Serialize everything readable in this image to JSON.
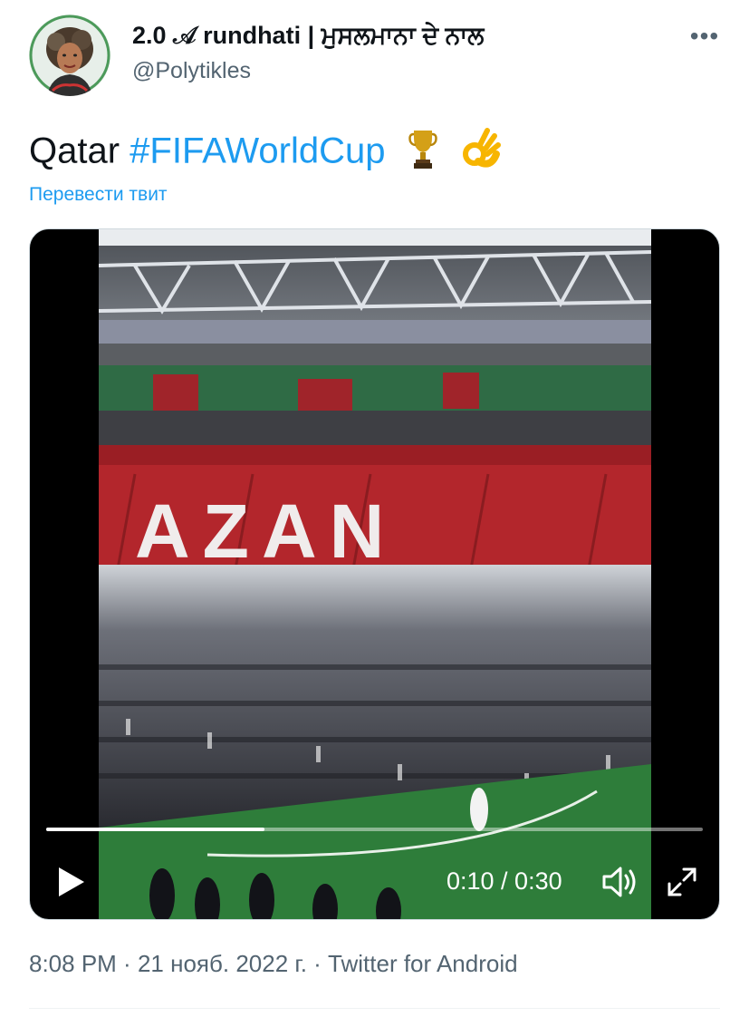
{
  "author": {
    "display_name": "2.0 𝒜 rundhati | ਮੁਸਲਮਾਨਾ ਦੇ ਨਾਲ",
    "handle": "@Polytikles",
    "avatar_icon": "portrait-avatar"
  },
  "more_icon": "more-horizontal-icon",
  "tweet": {
    "text_prefix": "Qatar ",
    "hashtag": "#FIFAWorldCup",
    "emoji_1": "trophy-emoji",
    "emoji_2": "ok-hand-emoji",
    "translate_label": "Перевести твит"
  },
  "video": {
    "current_time": "0:10",
    "duration": "0:30",
    "time_display": "0:10 / 0:30",
    "progress_fraction": 0.333,
    "stadium_banner_text": "AZAN",
    "play_icon": "play-icon",
    "volume_icon": "volume-icon",
    "fullscreen_icon": "fullscreen-icon"
  },
  "meta": {
    "time": "8:08 PM",
    "date": "21 нояб. 2022 г.",
    "source": "Twitter for Android",
    "separator": " · "
  },
  "colors": {
    "link": "#1d9bf0",
    "text": "#0f1419",
    "secondary": "#536471"
  }
}
